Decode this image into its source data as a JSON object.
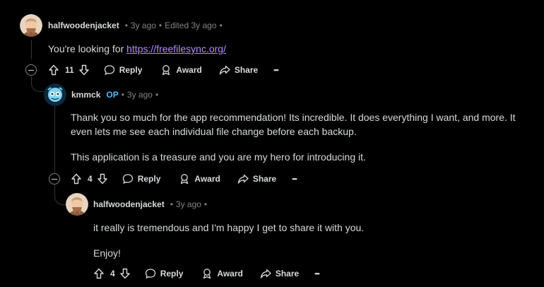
{
  "comments": [
    {
      "author": "halfwoodenjacket",
      "meta": "3y ago",
      "edited": "Edited 3y ago",
      "body_prefix": "You're looking for ",
      "link": "https://freefilesync.org/",
      "votes": "11"
    },
    {
      "author": "kmmck",
      "op_badge": "OP",
      "meta": "3y ago",
      "paragraph1": "Thank you so much for the app recommendation! Its incredible. It does everything I want, and more. It even lets me see each individual file change before each backup.",
      "paragraph2": "This application is a treasure and you are my hero for introducing it.",
      "votes": "4"
    },
    {
      "author": "halfwoodenjacket",
      "meta": "3y ago",
      "paragraph1": "it really is tremendous and I'm happy I get to share it with you.",
      "paragraph2": "Enjoy!",
      "votes": "4"
    }
  ],
  "actions": {
    "reply": "Reply",
    "award": "Award",
    "share": "Share",
    "more": "•••"
  },
  "separator": "•",
  "colors": {
    "background": "#000000",
    "text": "#d7dadc",
    "meta": "#818384",
    "link": "#b48cff",
    "op": "#4fbcff",
    "thread": "#343536"
  },
  "icons": [
    "user-avatar-icon",
    "upvote-icon",
    "downvote-icon",
    "reply-bubble-icon",
    "award-icon",
    "share-arrow-icon",
    "more-icon",
    "collapse-icon"
  ]
}
